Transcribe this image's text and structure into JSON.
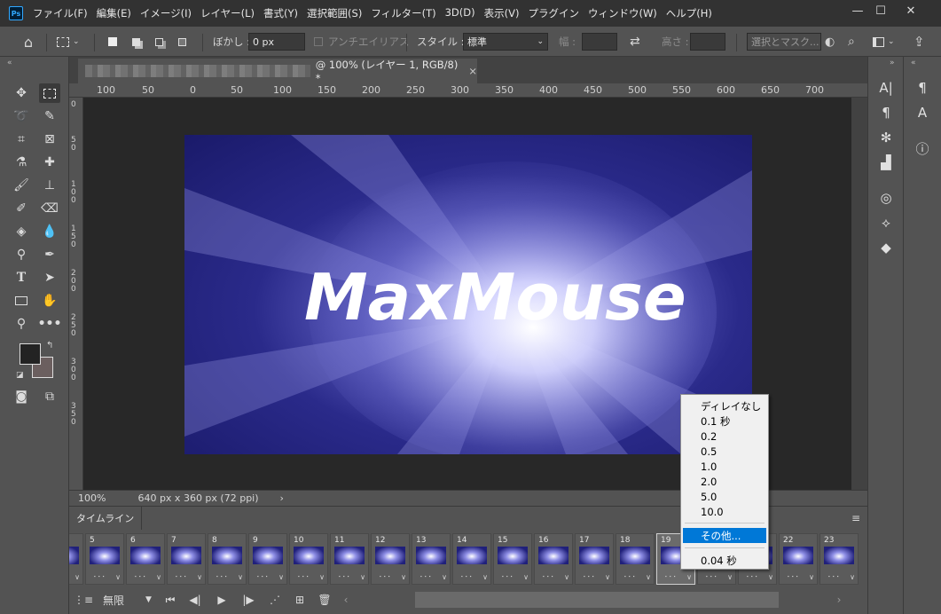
{
  "app": {
    "logo": "Ps",
    "window_controls": {
      "minimize": "—",
      "maximize": "☐",
      "close": "✕"
    }
  },
  "menubar": {
    "items": [
      "ファイル(F)",
      "編集(E)",
      "イメージ(I)",
      "レイヤー(L)",
      "書式(Y)",
      "選択範囲(S)",
      "フィルター(T)",
      "3D(D)",
      "表示(V)",
      "プラグイン",
      "ウィンドウ(W)",
      "ヘルプ(H)"
    ]
  },
  "options": {
    "feather_label": "ぼかし :",
    "feather_value": "0 px",
    "antialias_label": "アンチエイリアス",
    "style_label": "スタイル :",
    "style_value": "標準",
    "width_label": "幅 :",
    "height_label": "高さ :",
    "select_mask_label": "選択とマスク..."
  },
  "document": {
    "tab_title": "@ 100% (レイヤー 1, RGB/8) *",
    "tab_close": "×",
    "zoom": "100%",
    "info": "640 px x 360 px (72 ppi)",
    "info_arrow": "›",
    "artwork_text": "MaxMouse"
  },
  "rulers": {
    "h_labels": [
      "100",
      "50",
      "0",
      "50",
      "100",
      "150",
      "200",
      "250",
      "300",
      "350",
      "400",
      "450",
      "500",
      "550",
      "600",
      "650",
      "700"
    ],
    "v_labels": [
      "0",
      "5 0",
      "1 0 0",
      "1 5 0",
      "2 0 0",
      "2 5 0",
      "3 0 0",
      "3 5 0"
    ]
  },
  "timeline": {
    "tab_label": "タイムライン",
    "menu_icon": "≡",
    "frames": [
      "",
      "5",
      "6",
      "7",
      "8",
      "9",
      "10",
      "11",
      "12",
      "13",
      "14",
      "15",
      "16",
      "17",
      "18",
      "19",
      "20",
      "21",
      "22",
      "23"
    ],
    "selected_frame": "19",
    "loop_value": "無限",
    "delay_dots": "⠂⠂⠂"
  },
  "popup": {
    "items": [
      "ディレイなし",
      "0.1 秒",
      "0.2",
      "0.5",
      "1.0",
      "2.0",
      "5.0",
      "10.0",
      "その他...",
      "0.04 秒"
    ],
    "highlighted": "その他..."
  },
  "colors": {
    "foreground": "#232323",
    "background": "#6b5f5f",
    "highlight": "#0078d7"
  }
}
